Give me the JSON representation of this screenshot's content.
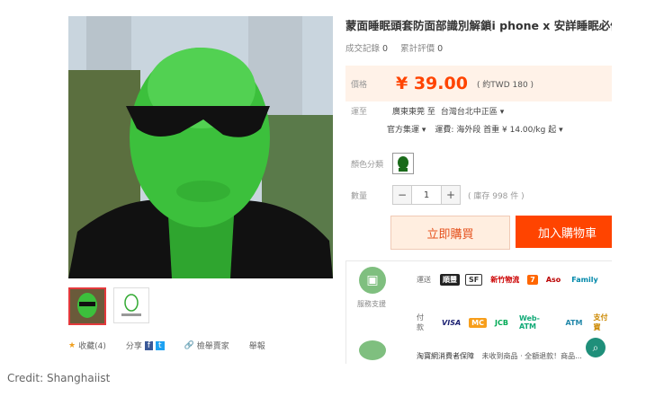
{
  "product": {
    "title": "蒙面睡眠頭套防面部識別解鎖i phone x 安詳睡眠必備",
    "sales_label": "成交記錄",
    "sales_count": "0",
    "reviews_label": "累計評價",
    "reviews_count": "0",
    "price_label": "價格",
    "price": "¥ 39.00",
    "price_converted": "( 約TWD 180 )",
    "shipping_label": "運至",
    "ship_from": "廣東東莞 至",
    "ship_to": "台灣台北中正區",
    "logistics": "官方集運",
    "freight": "運費: 海外段 首重 ¥ 14.00/kg 起",
    "color_label": "顏色分類",
    "qty_label": "數量",
    "qty_value": "1",
    "stock_text": "( 庫存 998 件 )",
    "buy_now": "立即購買",
    "add_to_cart": "加入購物車",
    "favorites": "收藏(4)",
    "share": "分享",
    "report": "檢舉賣家",
    "report2": "舉報"
  },
  "service": {
    "label": "服務支援",
    "ship_label": "運送",
    "pay_label": "付款",
    "guarantee": "淘寶網消費者保障",
    "guarantee_note": "未收到商品 · 全額退款！商品...",
    "logos": [
      "順豐",
      "SF",
      "新竹物流",
      "7",
      "Aso",
      "Family"
    ],
    "pay_logos": [
      "VISA",
      "MC",
      "JCB",
      "Web-ATM",
      "ATM",
      "支付寶"
    ]
  },
  "credit": "Credit: Shanghaiist",
  "colors": {
    "accent": "#ff4400",
    "price": "#ff4400",
    "mask": "#3cc03c"
  }
}
